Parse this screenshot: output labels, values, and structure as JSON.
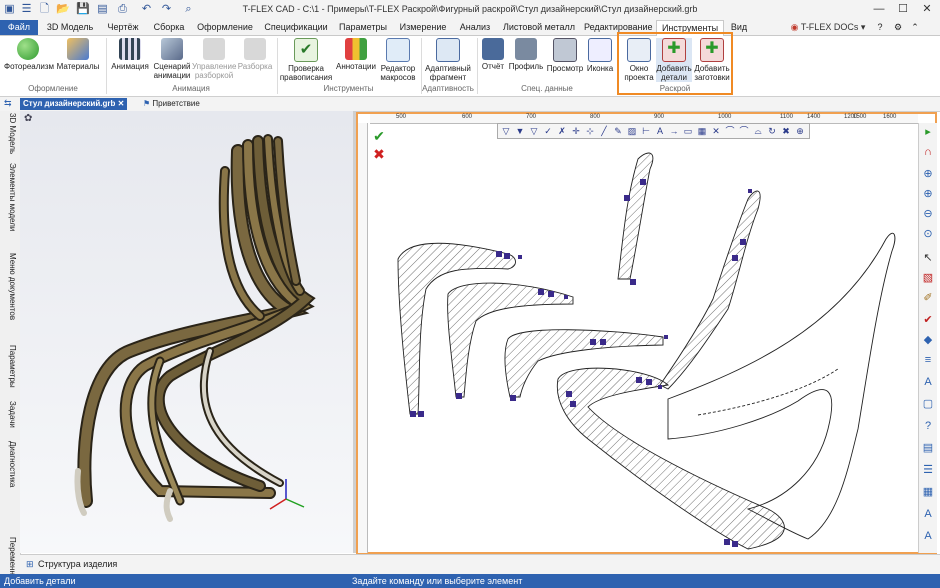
{
  "app": {
    "title": "T-FLEX CAD - C:\\1 - Примеры\\T-FLEX Раскрой\\Фигурный раскрой\\Стул дизайнерский\\Стул дизайнерский.grb",
    "docs_label": "T-FLEX DOCs",
    "docs_arrow": "▾"
  },
  "menu": [
    "Файл",
    "3D Модель",
    "Чертёж",
    "Сборка",
    "Оформление",
    "Спецификации",
    "Параметры",
    "Измерение",
    "Анализ",
    "Листовой металл",
    "Редактирование",
    "Инструменты",
    "Вид"
  ],
  "ribbon": {
    "groups": [
      {
        "label": "Оформление",
        "buttons": [
          "Фотореализм",
          "Материалы"
        ]
      },
      {
        "label": "Анимация",
        "buttons": [
          "Анимация",
          "Сценарий анимации",
          "Управление разборкой",
          "Разборка"
        ]
      },
      {
        "label": "Инструменты",
        "buttons": [
          "Проверка правописания",
          "Аннотации",
          "Редактор макросов"
        ]
      },
      {
        "label": "Адаптивность",
        "buttons": [
          "Адаптивный фрагмент"
        ]
      },
      {
        "label": "Спец. данные",
        "buttons": [
          "Отчёт",
          "Профиль",
          "Просмотр",
          "Иконка"
        ]
      },
      {
        "label": "Раскрой",
        "buttons": [
          "Окно проекта",
          "Добавить детали",
          "Добавить заготовки"
        ]
      }
    ]
  },
  "doc_tabs": {
    "active": "Стул дизайнерский.grb",
    "close": "✕",
    "other": "Приветствие"
  },
  "left_panel": [
    "3D Модель",
    "Элементы модели",
    "Меню документов",
    "Параметры",
    "Задачи",
    "Диагностика",
    "Переменные"
  ],
  "ruler": {
    "ticks": [
      "500",
      "600",
      "700",
      "800",
      "900",
      "1000",
      "1100",
      "1200",
      "1300",
      "1400",
      "1500",
      "1600"
    ]
  },
  "confirm": {
    "ok": "✔",
    "cancel": "✖"
  },
  "bottom": {
    "structure": "Структура изделия"
  },
  "status": {
    "left": "Добавить детали",
    "center": "Задайте команду или выберите элемент"
  },
  "colors": {
    "accent": "#2e62b0",
    "highlight": "#f08a24",
    "wood": "#6b5a35",
    "marker": "#3a2a8a"
  }
}
